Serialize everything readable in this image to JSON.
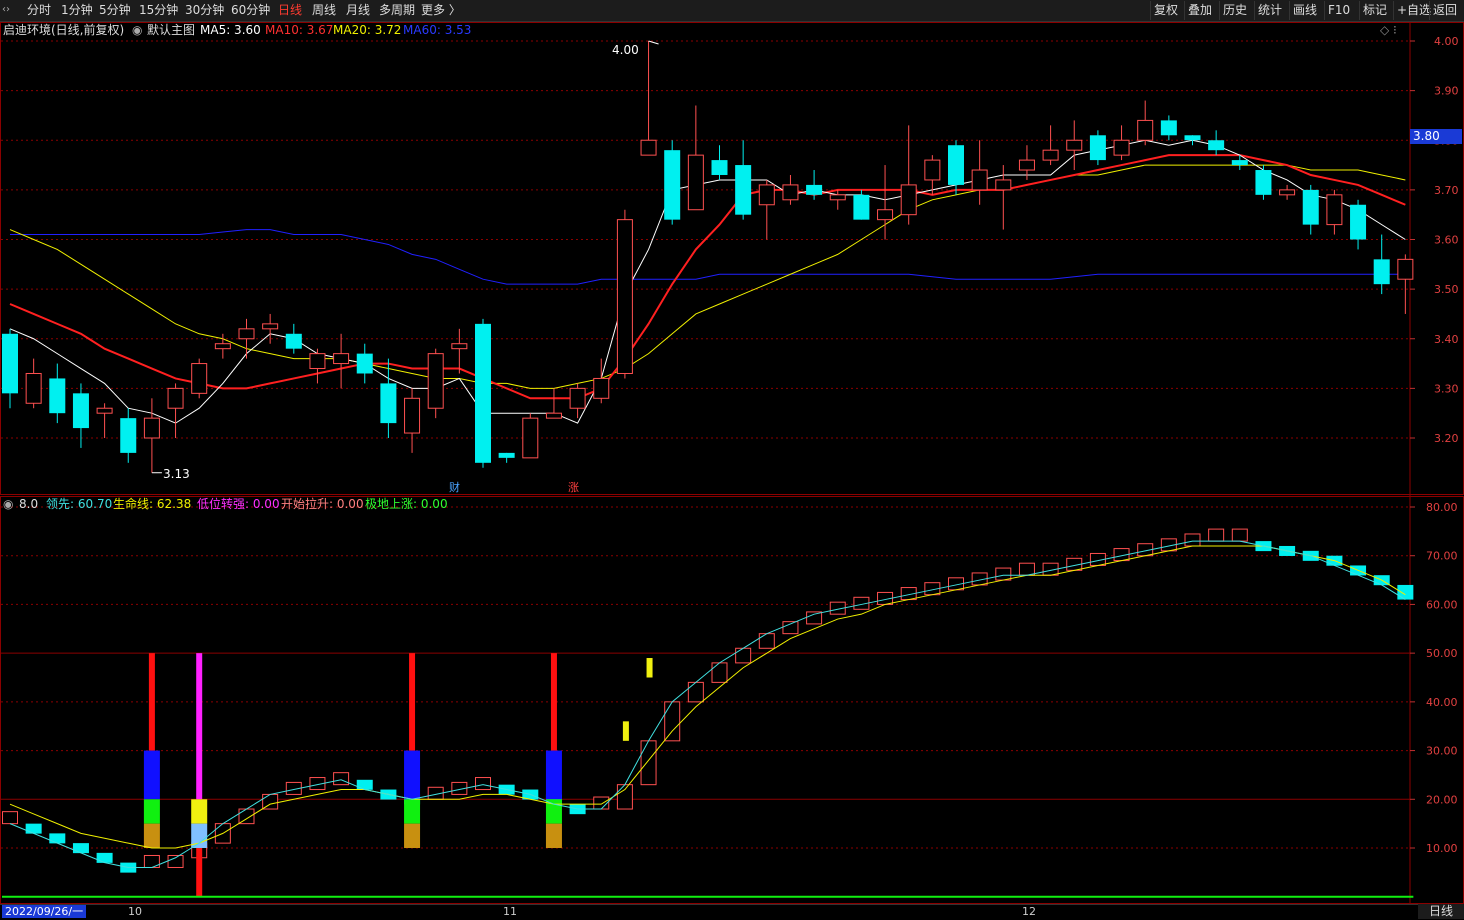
{
  "toolbar": {
    "periods": [
      "分时",
      "1分钟",
      "5分钟",
      "15分钟",
      "30分钟",
      "60分钟",
      "日线",
      "周线",
      "月线",
      "多周期",
      "更多 〉"
    ],
    "active_period": "日线",
    "right_buttons": [
      "复权",
      "叠加",
      "历史",
      "统计",
      "画线",
      "F10",
      "标记",
      "+自选",
      "返回"
    ]
  },
  "main_header": {
    "stock": "启迪环境(日线,前复权)",
    "template": "默认主图",
    "ma5_label": "MA5: 3.60",
    "ma10_label": "MA10: 3.67",
    "ma20_label": "MA20: 3.72",
    "ma60_label": "MA60: 3.53"
  },
  "sub_header": {
    "param": "8.0",
    "lead_label": "领先: 60.70",
    "life_label": "生命线: 62.38",
    "low_label": "低位转强: 0.00",
    "start_label": "开始拉升: 0.00",
    "bottom_label": "极地上涨: 0.00"
  },
  "annotations": {
    "high": "4.00",
    "low": "3.13",
    "cai": "财",
    "zhang": "涨"
  },
  "price_badge": "3.80",
  "price_ticks": [
    "4.00",
    "3.90",
    "3.80",
    "3.70",
    "3.60",
    "3.50",
    "3.40",
    "3.30",
    "3.20"
  ],
  "ind_ticks": [
    "80.00",
    "70.00",
    "60.00",
    "50.00",
    "40.00",
    "30.00",
    "20.00",
    "10.00"
  ],
  "date_start": "2022/09/26/一",
  "months": [
    "10",
    "11",
    "12"
  ],
  "period_label": "日线",
  "colors": {
    "up": "#ff5050",
    "down": "#00f0f0",
    "ma5": "#ffffff",
    "ma10": "#ff2020",
    "ma20": "#f0f000",
    "ma60": "#2020ff",
    "grid": "#8b0000"
  },
  "chart_data": [
    {
      "type": "candlestick",
      "ylim": [
        3.1,
        4.05
      ],
      "candles": [
        [
          3.41,
          3.29,
          3.42,
          3.26
        ],
        [
          3.27,
          3.33,
          3.36,
          3.26
        ],
        [
          3.32,
          3.25,
          3.35,
          3.23
        ],
        [
          3.29,
          3.22,
          3.31,
          3.18
        ],
        [
          3.25,
          3.26,
          3.27,
          3.2
        ],
        [
          3.24,
          3.17,
          3.26,
          3.15
        ],
        [
          3.2,
          3.24,
          3.28,
          3.13
        ],
        [
          3.26,
          3.3,
          3.31,
          3.2
        ],
        [
          3.29,
          3.35,
          3.36,
          3.28
        ],
        [
          3.38,
          3.39,
          3.41,
          3.36
        ],
        [
          3.4,
          3.42,
          3.44,
          3.36
        ],
        [
          3.42,
          3.43,
          3.45,
          3.39
        ],
        [
          3.41,
          3.38,
          3.43,
          3.37
        ],
        [
          3.34,
          3.37,
          3.38,
          3.31
        ],
        [
          3.35,
          3.37,
          3.41,
          3.3
        ],
        [
          3.37,
          3.33,
          3.39,
          3.31
        ],
        [
          3.31,
          3.23,
          3.36,
          3.2
        ],
        [
          3.21,
          3.28,
          3.3,
          3.17
        ],
        [
          3.26,
          3.37,
          3.38,
          3.24
        ],
        [
          3.38,
          3.39,
          3.42,
          3.33
        ],
        [
          3.43,
          3.15,
          3.44,
          3.14
        ],
        [
          3.17,
          3.16,
          3.17,
          3.15
        ],
        [
          3.16,
          3.24,
          3.25,
          3.16
        ],
        [
          3.24,
          3.25,
          3.3,
          3.24
        ],
        [
          3.26,
          3.3,
          3.31,
          3.24
        ],
        [
          3.28,
          3.32,
          3.36,
          3.27
        ],
        [
          3.33,
          3.64,
          3.66,
          3.32
        ],
        [
          3.77,
          3.8,
          4.0,
          3.77
        ],
        [
          3.78,
          3.64,
          3.8,
          3.63
        ],
        [
          3.66,
          3.77,
          3.87,
          3.66
        ],
        [
          3.76,
          3.73,
          3.79,
          3.72
        ],
        [
          3.75,
          3.65,
          3.8,
          3.64
        ],
        [
          3.67,
          3.71,
          3.72,
          3.6
        ],
        [
          3.68,
          3.71,
          3.73,
          3.67
        ],
        [
          3.71,
          3.69,
          3.74,
          3.68
        ],
        [
          3.68,
          3.69,
          3.7,
          3.66
        ],
        [
          3.69,
          3.64,
          3.7,
          3.64
        ],
        [
          3.64,
          3.66,
          3.75,
          3.6
        ],
        [
          3.65,
          3.71,
          3.83,
          3.63
        ],
        [
          3.72,
          3.76,
          3.77,
          3.69
        ],
        [
          3.79,
          3.71,
          3.8,
          3.69
        ],
        [
          3.7,
          3.74,
          3.8,
          3.67
        ],
        [
          3.7,
          3.72,
          3.75,
          3.62
        ],
        [
          3.74,
          3.76,
          3.79,
          3.72
        ],
        [
          3.76,
          3.78,
          3.83,
          3.75
        ],
        [
          3.78,
          3.8,
          3.84,
          3.74
        ],
        [
          3.81,
          3.76,
          3.82,
          3.75
        ],
        [
          3.77,
          3.8,
          3.83,
          3.76
        ],
        [
          3.8,
          3.84,
          3.88,
          3.79
        ],
        [
          3.84,
          3.81,
          3.85,
          3.8
        ],
        [
          3.81,
          3.8,
          3.81,
          3.79
        ],
        [
          3.8,
          3.78,
          3.82,
          3.77
        ],
        [
          3.76,
          3.75,
          3.77,
          3.74
        ],
        [
          3.74,
          3.69,
          3.75,
          3.68
        ],
        [
          3.69,
          3.7,
          3.71,
          3.68
        ],
        [
          3.7,
          3.63,
          3.71,
          3.61
        ],
        [
          3.63,
          3.69,
          3.7,
          3.61
        ],
        [
          3.67,
          3.6,
          3.68,
          3.58
        ],
        [
          3.56,
          3.51,
          3.61,
          3.49
        ],
        [
          3.52,
          3.56,
          3.57,
          3.45
        ]
      ],
      "ma5": [
        3.42,
        3.4,
        3.37,
        3.34,
        3.31,
        3.26,
        3.25,
        3.23,
        3.26,
        3.31,
        3.37,
        3.41,
        3.4,
        3.37,
        3.36,
        3.35,
        3.32,
        3.3,
        3.3,
        3.32,
        3.25,
        3.25,
        3.25,
        3.25,
        3.23,
        3.32,
        3.49,
        3.58,
        3.7,
        3.71,
        3.72,
        3.72,
        3.72,
        3.69,
        3.7,
        3.69,
        3.69,
        3.68,
        3.69,
        3.7,
        3.71,
        3.72,
        3.73,
        3.73,
        3.73,
        3.77,
        3.78,
        3.79,
        3.8,
        3.79,
        3.8,
        3.79,
        3.77,
        3.74,
        3.72,
        3.69,
        3.68,
        3.66,
        3.63,
        3.6
      ],
      "ma10": [
        3.47,
        3.45,
        3.43,
        3.41,
        3.38,
        3.36,
        3.34,
        3.32,
        3.31,
        3.3,
        3.3,
        3.31,
        3.32,
        3.33,
        3.34,
        3.35,
        3.35,
        3.34,
        3.34,
        3.34,
        3.32,
        3.3,
        3.28,
        3.28,
        3.28,
        3.3,
        3.36,
        3.43,
        3.51,
        3.58,
        3.63,
        3.69,
        3.7,
        3.7,
        3.69,
        3.7,
        3.7,
        3.7,
        3.7,
        3.69,
        3.7,
        3.7,
        3.7,
        3.71,
        3.72,
        3.73,
        3.74,
        3.75,
        3.76,
        3.77,
        3.77,
        3.77,
        3.77,
        3.76,
        3.75,
        3.73,
        3.72,
        3.71,
        3.69,
        3.67
      ],
      "ma20": [
        3.62,
        3.6,
        3.58,
        3.55,
        3.52,
        3.49,
        3.46,
        3.43,
        3.41,
        3.4,
        3.38,
        3.37,
        3.36,
        3.36,
        3.36,
        3.35,
        3.34,
        3.33,
        3.32,
        3.32,
        3.31,
        3.31,
        3.3,
        3.3,
        3.31,
        3.32,
        3.34,
        3.37,
        3.41,
        3.45,
        3.47,
        3.49,
        3.51,
        3.53,
        3.55,
        3.57,
        3.6,
        3.63,
        3.66,
        3.68,
        3.69,
        3.7,
        3.7,
        3.71,
        3.72,
        3.73,
        3.73,
        3.74,
        3.75,
        3.75,
        3.75,
        3.75,
        3.75,
        3.75,
        3.75,
        3.74,
        3.74,
        3.74,
        3.73,
        3.72
      ],
      "ma60": [
        3.61,
        3.61,
        3.61,
        3.61,
        3.61,
        3.61,
        3.61,
        3.61,
        3.61,
        3.615,
        3.62,
        3.62,
        3.61,
        3.61,
        3.61,
        3.6,
        3.59,
        3.57,
        3.56,
        3.54,
        3.52,
        3.51,
        3.51,
        3.51,
        3.51,
        3.52,
        3.52,
        3.52,
        3.52,
        3.52,
        3.53,
        3.53,
        3.53,
        3.53,
        3.53,
        3.53,
        3.53,
        3.53,
        3.53,
        3.525,
        3.52,
        3.52,
        3.52,
        3.52,
        3.52,
        3.525,
        3.53,
        3.53,
        3.53,
        3.53,
        3.53,
        3.53,
        3.53,
        3.53,
        3.53,
        3.53,
        3.53,
        3.53,
        3.53,
        3.53
      ]
    },
    {
      "type": "indicator",
      "ylim": [
        0,
        90
      ],
      "lead": [
        15,
        13,
        11,
        9,
        7,
        6,
        6,
        8,
        11,
        15,
        18,
        21,
        22,
        23,
        24,
        22,
        21,
        20,
        21,
        22,
        23,
        22,
        21,
        19,
        18,
        18,
        23,
        32,
        40,
        44,
        48,
        51,
        54,
        56,
        58,
        59,
        60,
        61,
        62,
        63,
        64,
        65,
        66,
        66,
        67,
        68,
        69,
        70,
        71,
        72,
        73,
        73,
        73,
        72,
        71,
        70,
        68,
        66,
        64,
        61
      ],
      "life": [
        19,
        17,
        15,
        13,
        12,
        11,
        10,
        10,
        11,
        13,
        16,
        19,
        20,
        21,
        22,
        22,
        21,
        20,
        20,
        20,
        21,
        21,
        20,
        19,
        19,
        19,
        22,
        28,
        34,
        39,
        43,
        47,
        50,
        53,
        55,
        57,
        58,
        60,
        61,
        62,
        63,
        64,
        65,
        66,
        66,
        67,
        68,
        69,
        70,
        71,
        72,
        72,
        72,
        72,
        71,
        70,
        69,
        67,
        65,
        62
      ],
      "strong": [
        null,
        null,
        null,
        null,
        null,
        null,
        null,
        null,
        null,
        null,
        null,
        null,
        null,
        null,
        null,
        null,
        null,
        null,
        null,
        null,
        null,
        null,
        null,
        null,
        null,
        null,
        32,
        45,
        null,
        null,
        null,
        null,
        null,
        null,
        null,
        null,
        null,
        null,
        null,
        null,
        null,
        null,
        null,
        null,
        null,
        null,
        null,
        null,
        null,
        null,
        null,
        null,
        null,
        null,
        null,
        null,
        null,
        null,
        null,
        null
      ]
    }
  ]
}
